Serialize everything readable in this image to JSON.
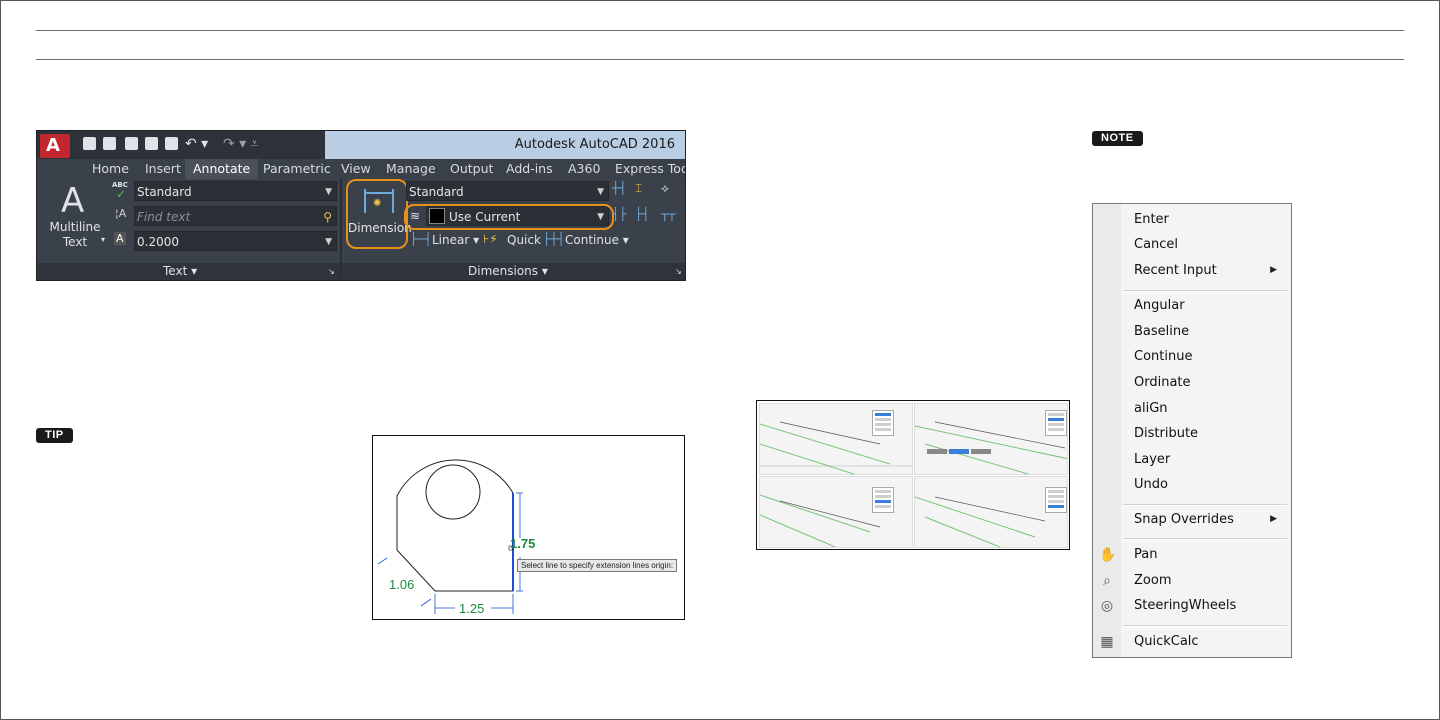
{
  "badges": {
    "note": "NOTE",
    "tip": "TIP"
  },
  "ribbon": {
    "app_title": "Autodesk AutoCAD 2016",
    "tabs": [
      "Home",
      "Insert",
      "Annotate",
      "Parametric",
      "View",
      "Manage",
      "Output",
      "Add-ins",
      "A360",
      "Express Tool"
    ],
    "active_tab": "Annotate",
    "text_panel": {
      "multiline_label_1": "Multiline",
      "multiline_label_2": "Text",
      "style_value": "Standard",
      "find_placeholder": "Find text",
      "height_value": "0.2000",
      "footer": "Text ▾",
      "spell_badge": "ABC"
    },
    "dim_panel": {
      "button_label": "Dimension",
      "style_value": "Standard",
      "layer_value": "Use Current",
      "linear": "Linear",
      "quick": "Quick",
      "continue": "Continue",
      "footer": "Dimensions ▾"
    }
  },
  "figure_dimension": {
    "tooltip": "Select line to specify extension lines origin:",
    "dim_1": "1.75",
    "dim_2": "1.06",
    "dim_3": "1.25"
  },
  "context_menu": {
    "items": [
      {
        "label": "Enter"
      },
      {
        "label": "Cancel"
      },
      {
        "label": "Recent Input",
        "submenu": true
      },
      {
        "label": "Angular"
      },
      {
        "label": "Baseline"
      },
      {
        "label": "Continue"
      },
      {
        "label": "Ordinate"
      },
      {
        "label": "aliGn"
      },
      {
        "label": "Distribute"
      },
      {
        "label": "Layer"
      },
      {
        "label": "Undo"
      },
      {
        "label": "Snap Overrides",
        "submenu": true
      },
      {
        "label": "Pan",
        "icon": "pan-icon"
      },
      {
        "label": "Zoom",
        "icon": "zoom-icon"
      },
      {
        "label": "SteeringWheels",
        "icon": "steering-wheels-icon"
      },
      {
        "label": "QuickCalc",
        "icon": "calculator-icon"
      }
    ]
  },
  "colors": {
    "accent_orange": "#e8901c",
    "dim_green": "#1a8a3c",
    "ribbon_bg": "#373d46"
  }
}
